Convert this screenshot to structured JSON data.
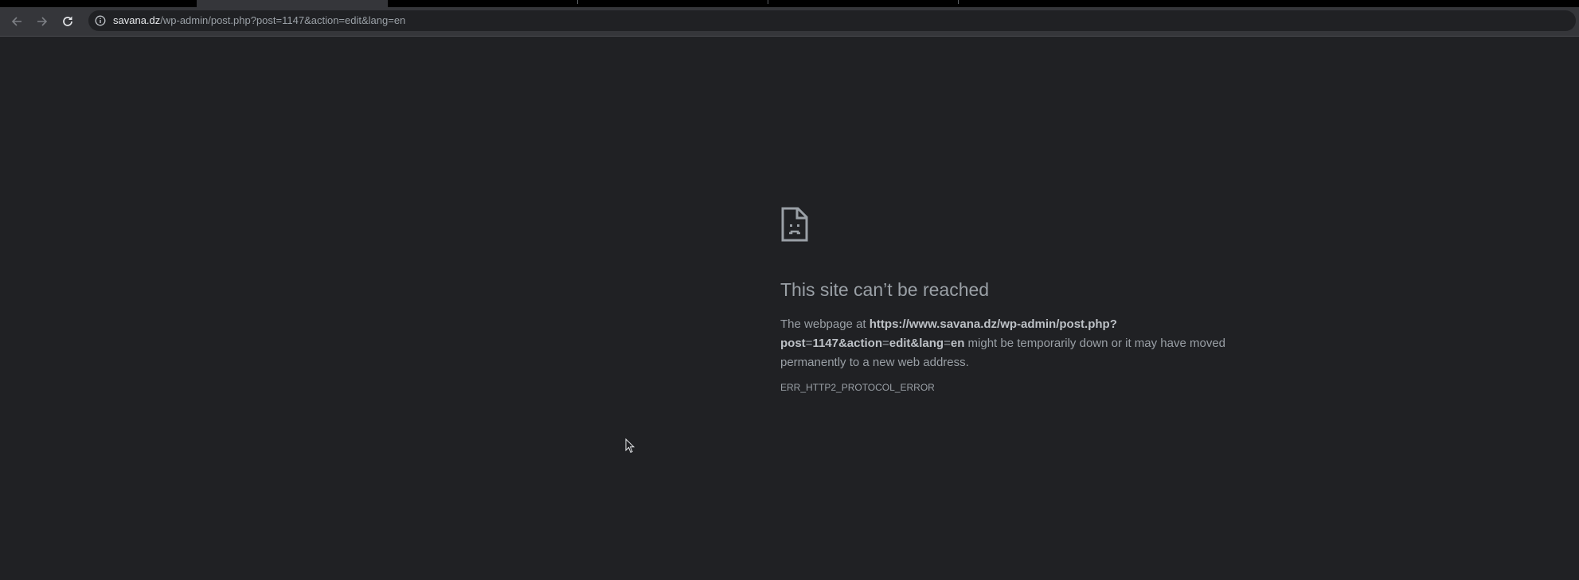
{
  "browser": {
    "url_host": "savana.dz",
    "url_path": "/wp-admin/post.php?post=1147&action=edit&lang=en",
    "back_icon": "arrow-left-icon",
    "forward_icon": "arrow-right-icon",
    "reload_icon": "reload-icon",
    "site_info_icon": "info-icon"
  },
  "error_page": {
    "icon": "sad-document-icon",
    "title": "This site can’t be reached",
    "message_prefix": "The webpage at ",
    "message_url_a": "https://www.savana.dz/wp-admin/post.php?",
    "message_url_b": "post",
    "message_url_c": "=",
    "message_url_d": "1147&action",
    "message_url_e": "=",
    "message_url_f": "edit&lang",
    "message_url_g": "=",
    "message_url_h": "en",
    "message_suffix": " might be temporarily down or it may have moved permanently to a new web address.",
    "error_code": "ERR_HTTP2_PROTOCOL_ERROR"
  },
  "colors": {
    "background": "#202124",
    "toolbar": "#35363a",
    "text": "#9aa0a6"
  }
}
